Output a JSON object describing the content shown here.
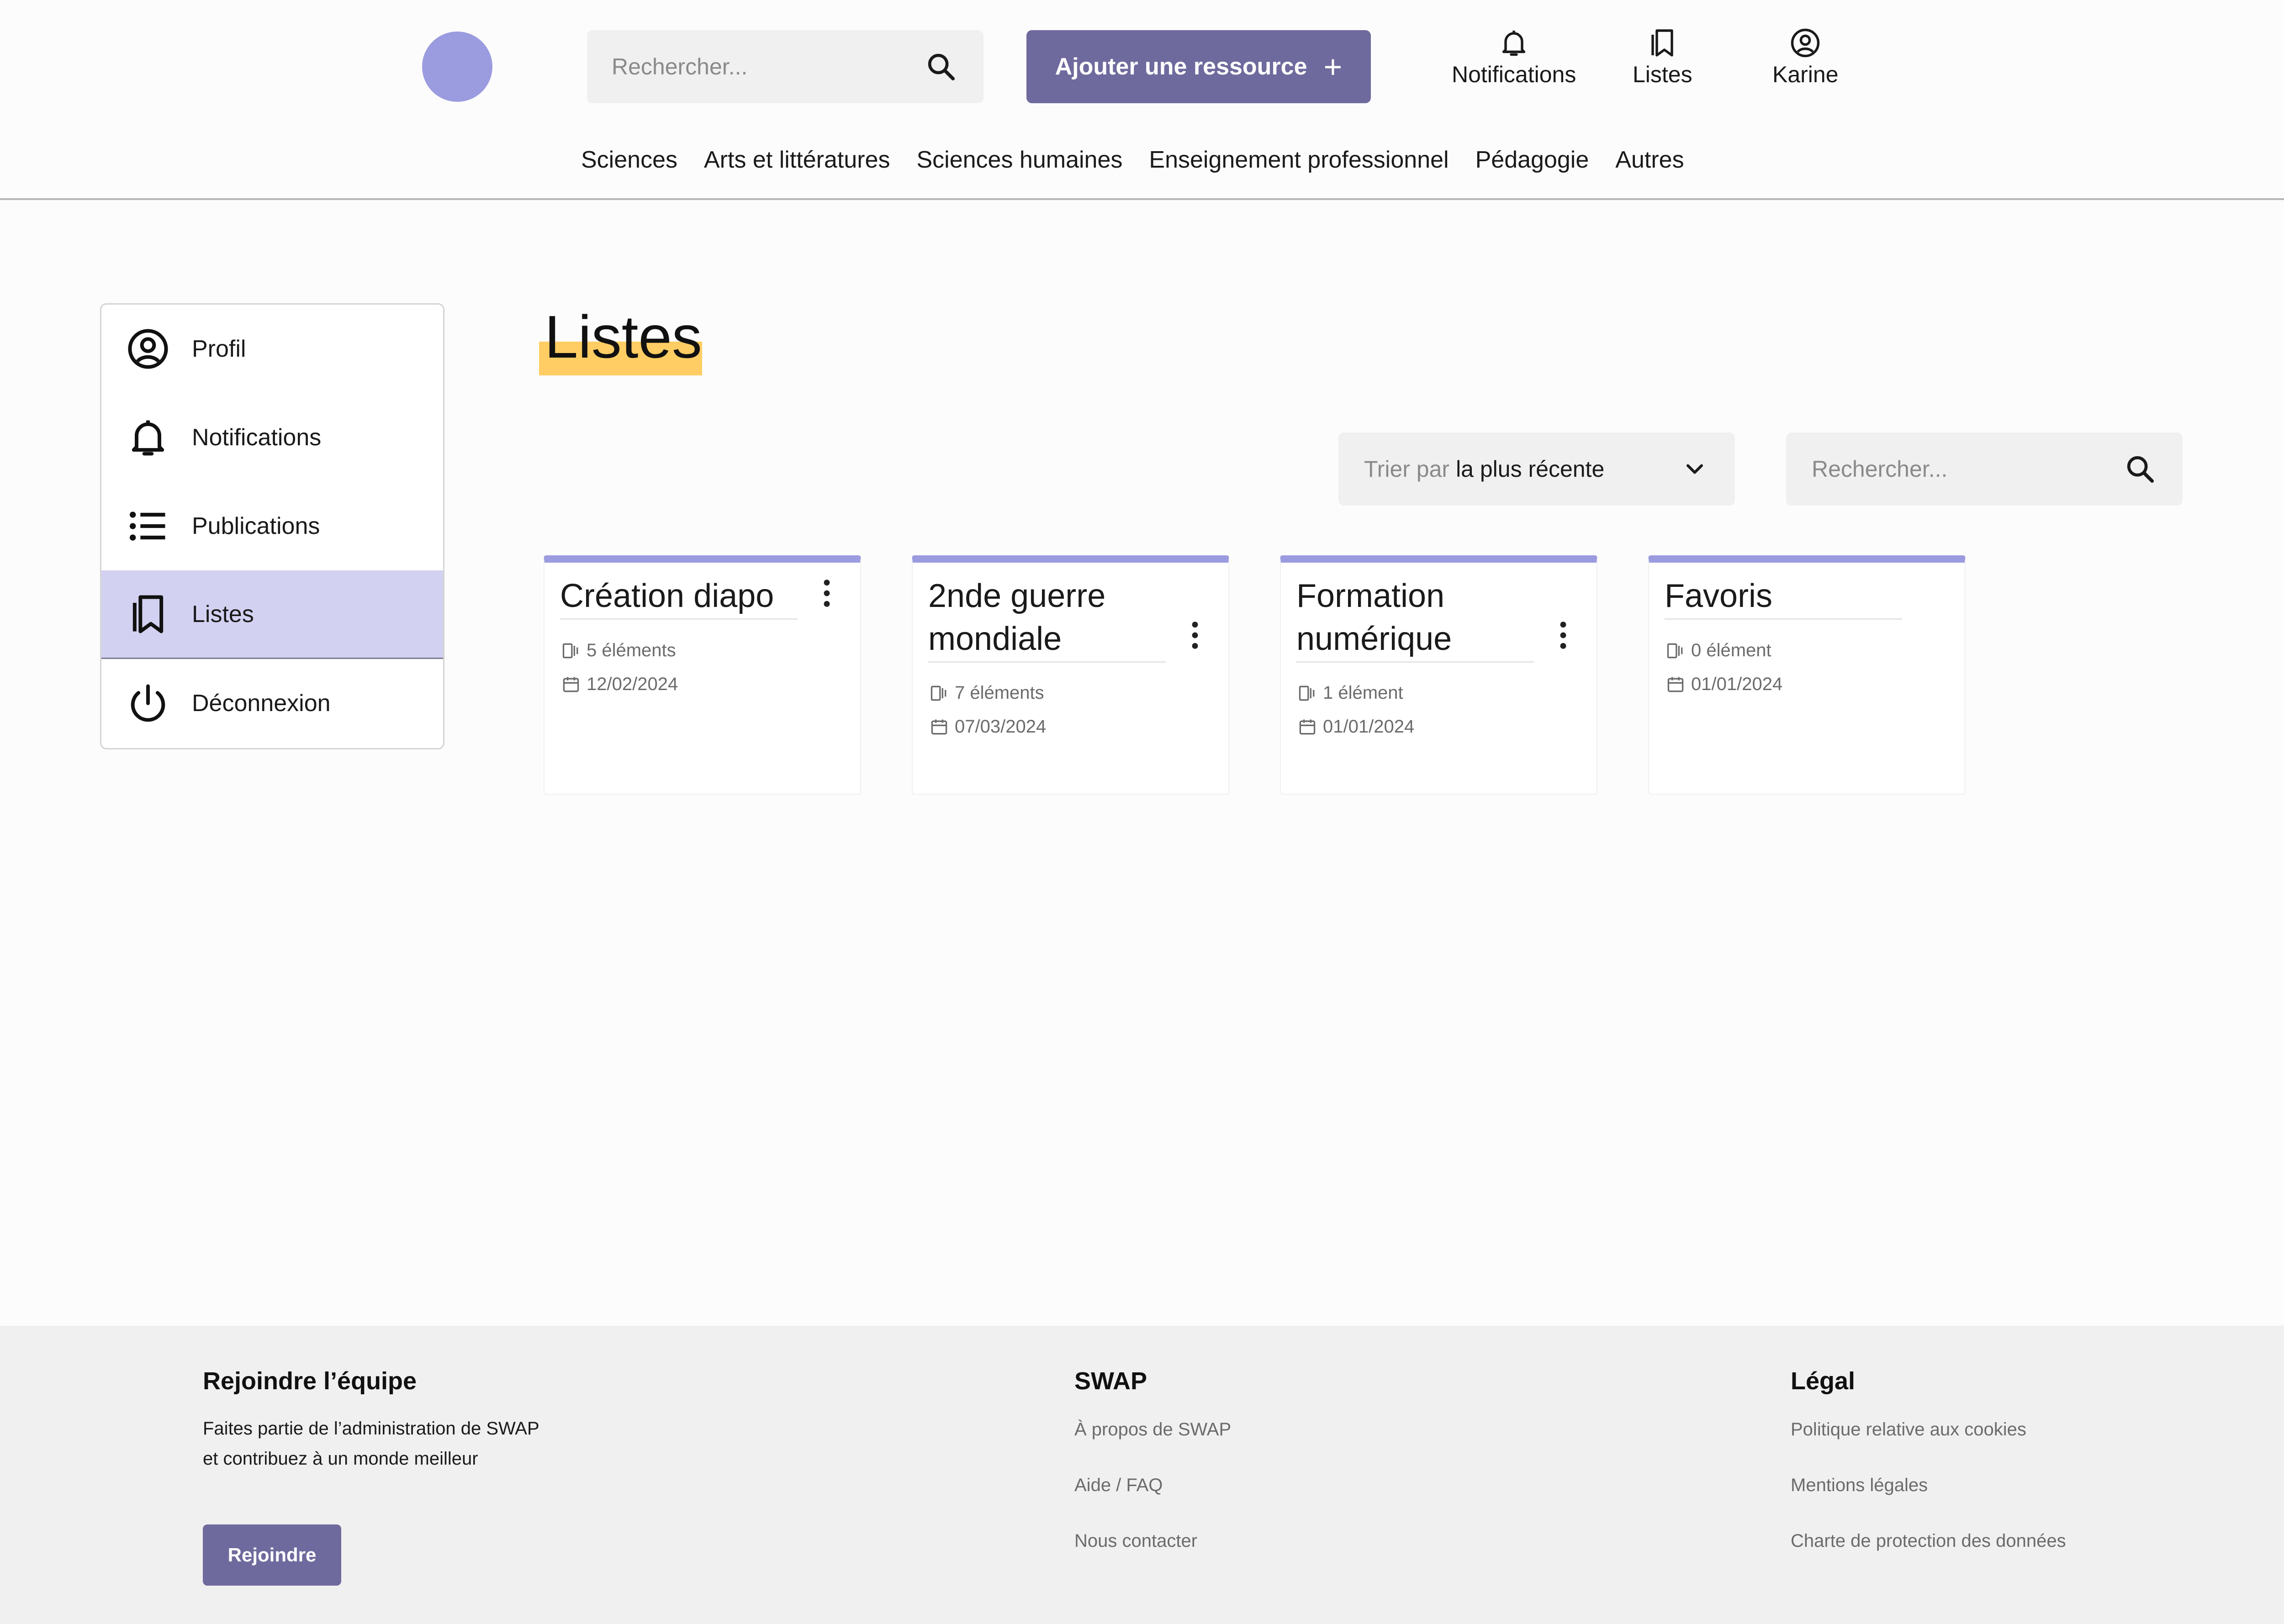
{
  "header": {
    "search_placeholder": "Rechercher...",
    "add_button": "Ajouter une ressource",
    "notifications": "Notifications",
    "lists": "Listes",
    "user": "Karine"
  },
  "categories": [
    "Sciences",
    "Arts et littératures",
    "Sciences humaines",
    "Enseignement professionnel",
    "Pédagogie",
    "Autres"
  ],
  "sidebar": {
    "items": [
      {
        "label": "Profil",
        "icon": "profile-icon"
      },
      {
        "label": "Notifications",
        "icon": "bell-icon"
      },
      {
        "label": "Publications",
        "icon": "list-icon"
      },
      {
        "label": "Listes",
        "icon": "bookmarks-icon",
        "active": true
      },
      {
        "label": "Déconnexion",
        "icon": "power-icon"
      }
    ]
  },
  "main": {
    "title": "Listes",
    "sort_prefix": "Trier par",
    "sort_value": "la plus récente",
    "search_placeholder": "Rechercher..."
  },
  "cards": [
    {
      "title": "Création diapo",
      "count": "5 éléments",
      "date": "12/02/2024"
    },
    {
      "title": "2nde guerre mondiale",
      "count": "7 éléments",
      "date": "07/03/2024"
    },
    {
      "title": "Formation numérique",
      "count": "1 élément",
      "date": "01/01/2024"
    },
    {
      "title": "Favoris",
      "count": "0 élément",
      "date": "01/01/2024"
    }
  ],
  "footer": {
    "join": {
      "title": "Rejoindre l’équipe",
      "text": "Faites partie de l’administration de SWAP et contribuez à un monde meilleur",
      "button": "Rejoindre"
    },
    "swap": {
      "title": "SWAP",
      "links": [
        "À propos de SWAP",
        "Aide / FAQ",
        "Nous contacter"
      ]
    },
    "legal": {
      "title": "Légal",
      "links": [
        "Politique relative aux cookies",
        "Mentions légales",
        "Charte de protection des données"
      ]
    }
  },
  "colors": {
    "accent": "#6f6a9d",
    "logo": "#9b9be0",
    "active_item": "#d3d1f1",
    "highlight": "#ffcd63"
  }
}
